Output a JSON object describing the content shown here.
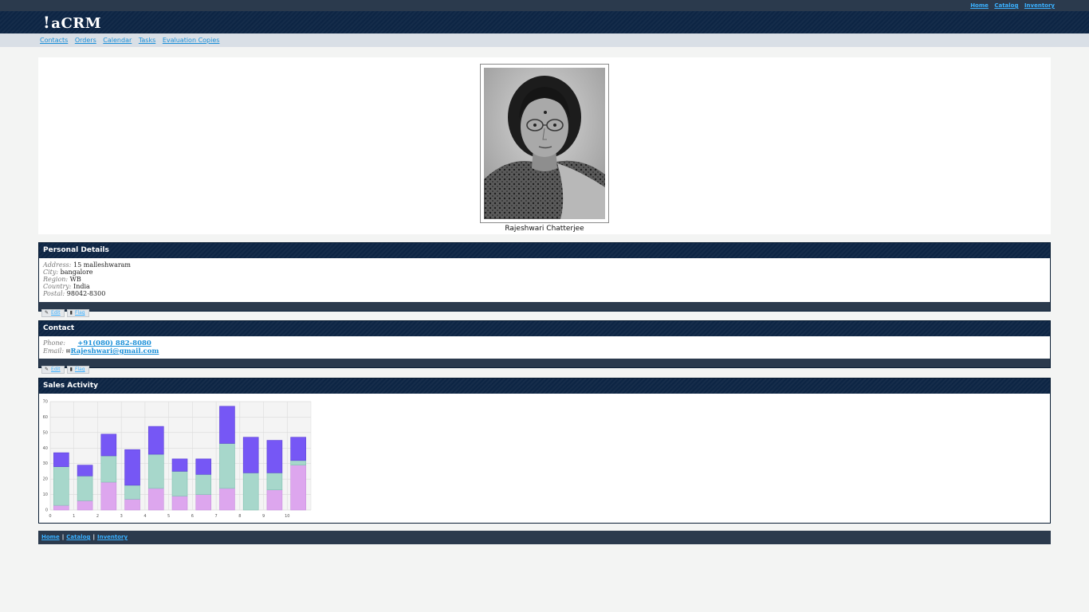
{
  "top_links": [
    "Home",
    "Catalog",
    "Inventory"
  ],
  "app_title": "aCRM",
  "app_logo_mark": "!",
  "nav": [
    "Contacts",
    "Orders",
    "Calendar",
    "Tasks",
    "Evaluation Copies"
  ],
  "contact_name": "Rajeshwari Chatterjee",
  "personal": {
    "title": "Personal Details",
    "fields": [
      {
        "label": "Address:",
        "value": "15 malleshwaram"
      },
      {
        "label": "City:",
        "value": "bangalore"
      },
      {
        "label": "Region:",
        "value": "WB"
      },
      {
        "label": "Country:",
        "value": "India"
      },
      {
        "label": "Postal:",
        "value": "98042-8300"
      }
    ],
    "edit_label": "Edit",
    "flag_label": "Flag"
  },
  "contact": {
    "title": "Contact",
    "phone_label": "Phone:",
    "phone": "+91(080) 882-8080",
    "email_label": "Email:",
    "email": "Rajeshwari@gmail.com",
    "edit_label": "Edit",
    "flag_label": "Flag"
  },
  "sales": {
    "title": "Sales Activity"
  },
  "chart_data": {
    "type": "bar",
    "stacked": true,
    "categories": [
      "0",
      "1",
      "2",
      "3",
      "4",
      "5",
      "6",
      "7",
      "8",
      "9",
      "10"
    ],
    "series": [
      {
        "color": "#dda6ee",
        "values": [
          3,
          6,
          18,
          7,
          14,
          9,
          10,
          14,
          0,
          13,
          29
        ]
      },
      {
        "color": "#a7d7cb",
        "values": [
          25,
          16,
          17,
          9,
          22,
          16,
          13,
          29,
          24,
          11,
          3
        ]
      },
      {
        "color": "#7657f5",
        "values": [
          9,
          7,
          14,
          23,
          18,
          8,
          10,
          24,
          23,
          21,
          15
        ]
      }
    ],
    "ylim": [
      0,
      70
    ],
    "yticks": [
      0,
      10,
      20,
      30,
      40,
      50,
      60,
      70
    ],
    "grid": true
  },
  "footer_links": [
    "Home",
    "Catalog",
    "Inventory"
  ]
}
